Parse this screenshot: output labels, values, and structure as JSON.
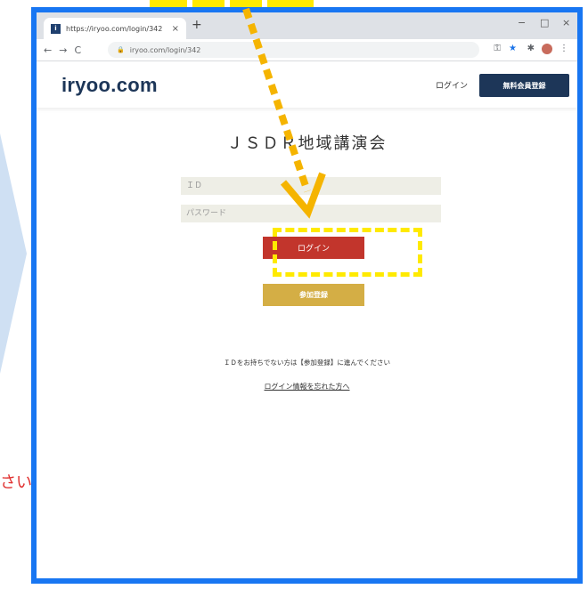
{
  "background": {
    "side_text": "さい"
  },
  "browser": {
    "tab_title": "https://iryoo.com/login/342",
    "tab_close": "×",
    "new_tab": "+",
    "minimize": "−",
    "maximize": "□",
    "close": "×",
    "back": "←",
    "forward": "→",
    "reload": "C",
    "url": "iryoo.com/login/342"
  },
  "header": {
    "logo": "iryoo.com",
    "login_link": "ログイン",
    "register_button": "無料会員登録"
  },
  "main": {
    "title": "ＪＳＤＲ地域講演会",
    "id_placeholder": "ＩＤ",
    "password_placeholder": "パスワード",
    "login_button": "ログイン",
    "join_button": "参加登録",
    "hint_text": "ＩＤをお持ちでない方は【参加登録】に進んでください",
    "forgot_link": "ログイン情報を忘れた方へ"
  },
  "colors": {
    "frame": "#1876f2",
    "brand_navy": "#1d3658",
    "login_red": "#c2352c",
    "join_gold": "#d4ae45",
    "annotation_yellow": "#ffea00",
    "arrow_orange": "#f5b400"
  }
}
